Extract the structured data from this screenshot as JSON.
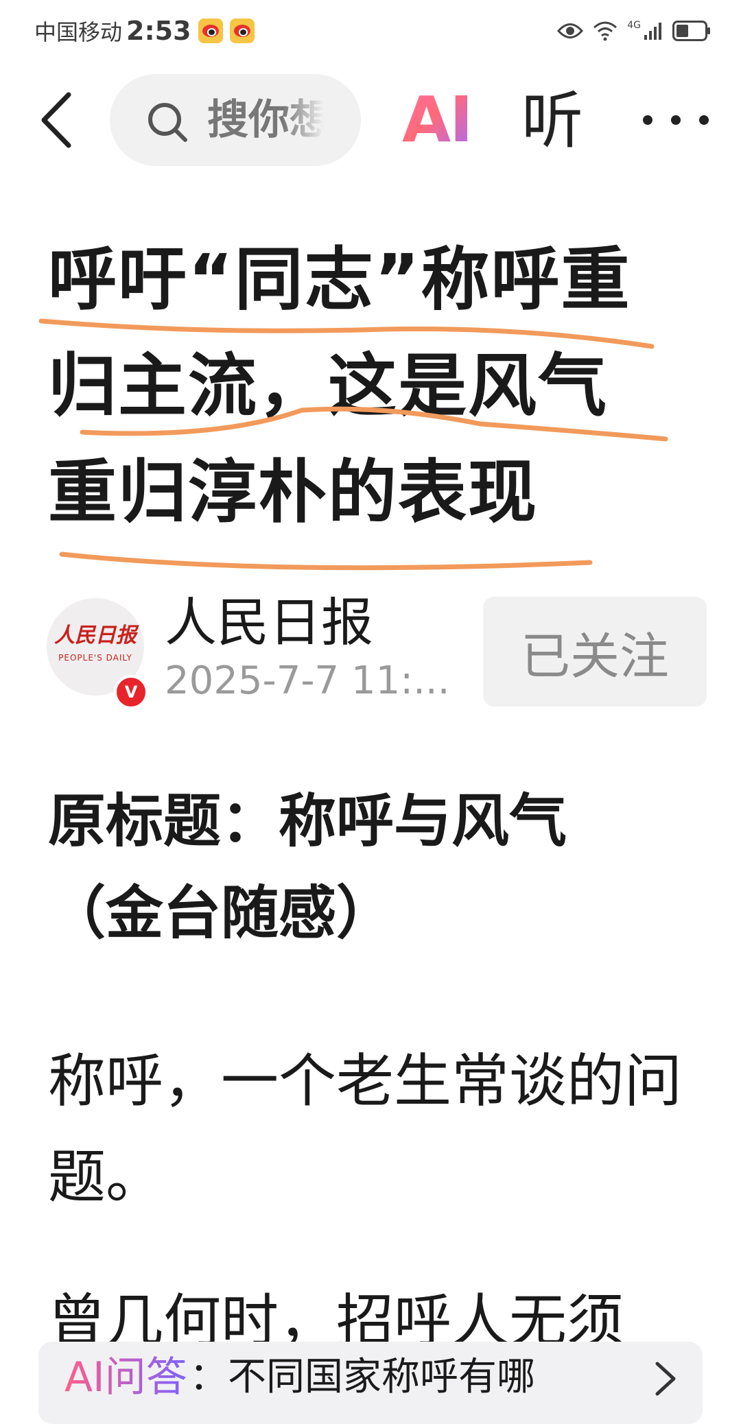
{
  "status_bar": {
    "carrier": "中国移动",
    "time": "2:53",
    "network_label": "4G"
  },
  "nav": {
    "search_placeholder": "搜你想",
    "ai_label": "AI",
    "listen_label": "听"
  },
  "article": {
    "headline": "呼吁“同志”称呼重归主流，这是风气重归淳朴的表现",
    "author": {
      "name": "人民日报",
      "avatar_text": "人民日报",
      "avatar_sub": "PEOPLE'S DAILY",
      "verified_mark": "V",
      "time": "2025-7-7 11:...",
      "follow_label": "已关注"
    },
    "original_title_line1": "原标题：称呼与风气",
    "original_title_line2": "（金台随感）",
    "paragraphs": [
      "称呼，一个老生常谈的问题。",
      "曾几何时，招呼人无须"
    ]
  },
  "ai_qa": {
    "label": "AI问答",
    "text": "：不同国家称呼有哪"
  },
  "colors": {
    "underline": "#f29a5b",
    "verified": "#e8242b",
    "brand_red": "#c8221c"
  }
}
